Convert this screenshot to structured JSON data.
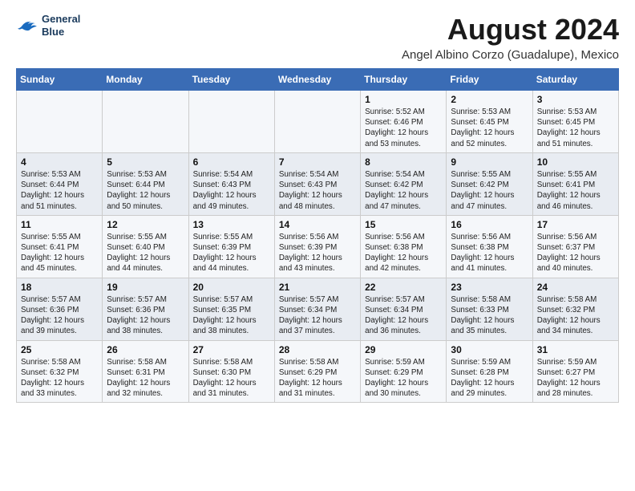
{
  "logo": {
    "line1": "General",
    "line2": "Blue"
  },
  "title": "August 2024",
  "location": "Angel Albino Corzo (Guadalupe), Mexico",
  "days_of_week": [
    "Sunday",
    "Monday",
    "Tuesday",
    "Wednesday",
    "Thursday",
    "Friday",
    "Saturday"
  ],
  "weeks": [
    [
      {
        "day": "",
        "info": ""
      },
      {
        "day": "",
        "info": ""
      },
      {
        "day": "",
        "info": ""
      },
      {
        "day": "",
        "info": ""
      },
      {
        "day": "1",
        "info": "Sunrise: 5:52 AM\nSunset: 6:46 PM\nDaylight: 12 hours\nand 53 minutes."
      },
      {
        "day": "2",
        "info": "Sunrise: 5:53 AM\nSunset: 6:45 PM\nDaylight: 12 hours\nand 52 minutes."
      },
      {
        "day": "3",
        "info": "Sunrise: 5:53 AM\nSunset: 6:45 PM\nDaylight: 12 hours\nand 51 minutes."
      }
    ],
    [
      {
        "day": "4",
        "info": "Sunrise: 5:53 AM\nSunset: 6:44 PM\nDaylight: 12 hours\nand 51 minutes."
      },
      {
        "day": "5",
        "info": "Sunrise: 5:53 AM\nSunset: 6:44 PM\nDaylight: 12 hours\nand 50 minutes."
      },
      {
        "day": "6",
        "info": "Sunrise: 5:54 AM\nSunset: 6:43 PM\nDaylight: 12 hours\nand 49 minutes."
      },
      {
        "day": "7",
        "info": "Sunrise: 5:54 AM\nSunset: 6:43 PM\nDaylight: 12 hours\nand 48 minutes."
      },
      {
        "day": "8",
        "info": "Sunrise: 5:54 AM\nSunset: 6:42 PM\nDaylight: 12 hours\nand 47 minutes."
      },
      {
        "day": "9",
        "info": "Sunrise: 5:55 AM\nSunset: 6:42 PM\nDaylight: 12 hours\nand 47 minutes."
      },
      {
        "day": "10",
        "info": "Sunrise: 5:55 AM\nSunset: 6:41 PM\nDaylight: 12 hours\nand 46 minutes."
      }
    ],
    [
      {
        "day": "11",
        "info": "Sunrise: 5:55 AM\nSunset: 6:41 PM\nDaylight: 12 hours\nand 45 minutes."
      },
      {
        "day": "12",
        "info": "Sunrise: 5:55 AM\nSunset: 6:40 PM\nDaylight: 12 hours\nand 44 minutes."
      },
      {
        "day": "13",
        "info": "Sunrise: 5:55 AM\nSunset: 6:39 PM\nDaylight: 12 hours\nand 44 minutes."
      },
      {
        "day": "14",
        "info": "Sunrise: 5:56 AM\nSunset: 6:39 PM\nDaylight: 12 hours\nand 43 minutes."
      },
      {
        "day": "15",
        "info": "Sunrise: 5:56 AM\nSunset: 6:38 PM\nDaylight: 12 hours\nand 42 minutes."
      },
      {
        "day": "16",
        "info": "Sunrise: 5:56 AM\nSunset: 6:38 PM\nDaylight: 12 hours\nand 41 minutes."
      },
      {
        "day": "17",
        "info": "Sunrise: 5:56 AM\nSunset: 6:37 PM\nDaylight: 12 hours\nand 40 minutes."
      }
    ],
    [
      {
        "day": "18",
        "info": "Sunrise: 5:57 AM\nSunset: 6:36 PM\nDaylight: 12 hours\nand 39 minutes."
      },
      {
        "day": "19",
        "info": "Sunrise: 5:57 AM\nSunset: 6:36 PM\nDaylight: 12 hours\nand 38 minutes."
      },
      {
        "day": "20",
        "info": "Sunrise: 5:57 AM\nSunset: 6:35 PM\nDaylight: 12 hours\nand 38 minutes."
      },
      {
        "day": "21",
        "info": "Sunrise: 5:57 AM\nSunset: 6:34 PM\nDaylight: 12 hours\nand 37 minutes."
      },
      {
        "day": "22",
        "info": "Sunrise: 5:57 AM\nSunset: 6:34 PM\nDaylight: 12 hours\nand 36 minutes."
      },
      {
        "day": "23",
        "info": "Sunrise: 5:58 AM\nSunset: 6:33 PM\nDaylight: 12 hours\nand 35 minutes."
      },
      {
        "day": "24",
        "info": "Sunrise: 5:58 AM\nSunset: 6:32 PM\nDaylight: 12 hours\nand 34 minutes."
      }
    ],
    [
      {
        "day": "25",
        "info": "Sunrise: 5:58 AM\nSunset: 6:32 PM\nDaylight: 12 hours\nand 33 minutes."
      },
      {
        "day": "26",
        "info": "Sunrise: 5:58 AM\nSunset: 6:31 PM\nDaylight: 12 hours\nand 32 minutes."
      },
      {
        "day": "27",
        "info": "Sunrise: 5:58 AM\nSunset: 6:30 PM\nDaylight: 12 hours\nand 31 minutes."
      },
      {
        "day": "28",
        "info": "Sunrise: 5:58 AM\nSunset: 6:29 PM\nDaylight: 12 hours\nand 31 minutes."
      },
      {
        "day": "29",
        "info": "Sunrise: 5:59 AM\nSunset: 6:29 PM\nDaylight: 12 hours\nand 30 minutes."
      },
      {
        "day": "30",
        "info": "Sunrise: 5:59 AM\nSunset: 6:28 PM\nDaylight: 12 hours\nand 29 minutes."
      },
      {
        "day": "31",
        "info": "Sunrise: 5:59 AM\nSunset: 6:27 PM\nDaylight: 12 hours\nand 28 minutes."
      }
    ]
  ]
}
